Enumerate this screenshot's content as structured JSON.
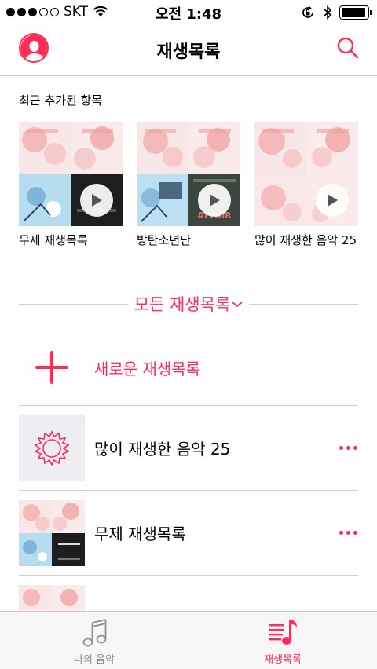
{
  "status_bar": {
    "carrier": "SKT",
    "time": "오전 1:48",
    "signal_bars_filled": 3,
    "signal_bars_total": 5,
    "battery_fill": 0.95
  },
  "nav": {
    "title": "재생목록",
    "profile_icon": "profile-avatar-icon",
    "search_icon": "search-icon"
  },
  "recent": {
    "header": "최근 추가된 항목",
    "items": [
      {
        "title": "무제 재생목록",
        "br_caption": ""
      },
      {
        "title": "방탄소년단",
        "br_caption": "AFFAIR"
      },
      {
        "title": "많이 재생한 음악 25",
        "br_caption": ""
      }
    ]
  },
  "all_playlists": {
    "label": "모든 재생목록",
    "chevron": "chevron-down-icon"
  },
  "new_playlist": {
    "label": "새로운 재생목록"
  },
  "playlists": [
    {
      "label": "많이 재생한 음악 25",
      "thumb": "gear-icon"
    },
    {
      "label": "무제 재생목록",
      "thumb": "album-collage"
    },
    {
      "label": "",
      "thumb": "album-collage"
    }
  ],
  "tabs": [
    {
      "label": "나의 음악",
      "icon": "music-note-icon",
      "active": false
    },
    {
      "label": "재생목록",
      "icon": "playlist-icon",
      "active": true
    }
  ],
  "colors": {
    "accent": "#ff2d55",
    "tabbar_bg": "#f7f7f7",
    "separator": "#d1d1d6",
    "inactive": "#8e8e93"
  }
}
